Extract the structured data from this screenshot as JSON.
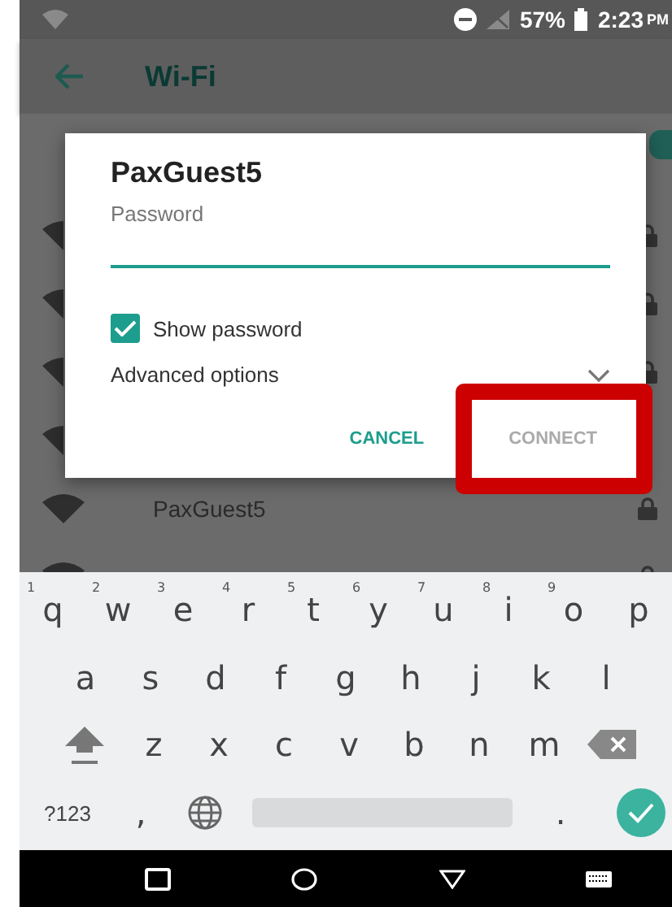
{
  "status_bar": {
    "battery": "57%",
    "time": "2:23",
    "ampm": "PM"
  },
  "app_bar": {
    "title": "Wi-Fi"
  },
  "wifi_switch": {
    "on": true
  },
  "networks": [
    {
      "kind": "covered",
      "locked": true
    },
    {
      "kind": "covered",
      "locked": true
    },
    {
      "kind": "covered",
      "locked": true
    },
    {
      "kind": "covered"
    },
    {
      "kind": "network",
      "name": "PaxGuest5",
      "locked": true
    },
    {
      "kind": "network",
      "locked": true
    }
  ],
  "dialog": {
    "title": "PaxGuest5",
    "field_label": "Password",
    "show_password": {
      "label": "Show password",
      "checked": true
    },
    "advanced": {
      "label": "Advanced options",
      "expanded": false
    },
    "buttons": [
      {
        "label": "CANCEL",
        "disabled": false
      },
      {
        "label": "CONNECT",
        "disabled": true,
        "highlighted": true
      }
    ]
  },
  "keyboard": {
    "rows": [
      [
        {
          "kind": "letter",
          "label": "q",
          "hint": "1"
        },
        {
          "kind": "letter",
          "label": "w",
          "hint": "2"
        },
        {
          "kind": "letter",
          "label": "e",
          "hint": "3"
        },
        {
          "kind": "letter",
          "label": "r",
          "hint": "4"
        },
        {
          "kind": "letter",
          "label": "t",
          "hint": "5"
        },
        {
          "kind": "letter",
          "label": "y",
          "hint": "6"
        },
        {
          "kind": "letter",
          "label": "u",
          "hint": "7"
        },
        {
          "kind": "letter",
          "label": "i",
          "hint": "8"
        },
        {
          "kind": "letter",
          "label": "o",
          "hint": "9"
        },
        {
          "kind": "letter",
          "label": "p"
        }
      ],
      [
        {
          "kind": "letter",
          "label": "a"
        },
        {
          "kind": "letter",
          "label": "s"
        },
        {
          "kind": "letter",
          "label": "d"
        },
        {
          "kind": "letter",
          "label": "f"
        },
        {
          "kind": "letter",
          "label": "g"
        },
        {
          "kind": "letter",
          "label": "h"
        },
        {
          "kind": "letter",
          "label": "j"
        },
        {
          "kind": "letter",
          "label": "k"
        },
        {
          "kind": "letter",
          "label": "l"
        }
      ],
      [
        {
          "kind": "shift"
        },
        {
          "kind": "letter",
          "label": "z"
        },
        {
          "kind": "letter",
          "label": "x"
        },
        {
          "kind": "letter",
          "label": "c"
        },
        {
          "kind": "letter",
          "label": "v"
        },
        {
          "kind": "letter",
          "label": "b"
        },
        {
          "kind": "letter",
          "label": "n"
        },
        {
          "kind": "letter",
          "label": "m"
        },
        {
          "kind": "backspace"
        }
      ],
      [
        {
          "kind": "symbols",
          "label": "?123"
        },
        {
          "kind": "letter",
          "label": ","
        },
        {
          "kind": "globe"
        },
        {
          "kind": "space"
        },
        {
          "kind": "letter",
          "label": "."
        },
        {
          "kind": "enter"
        }
      ]
    ]
  }
}
